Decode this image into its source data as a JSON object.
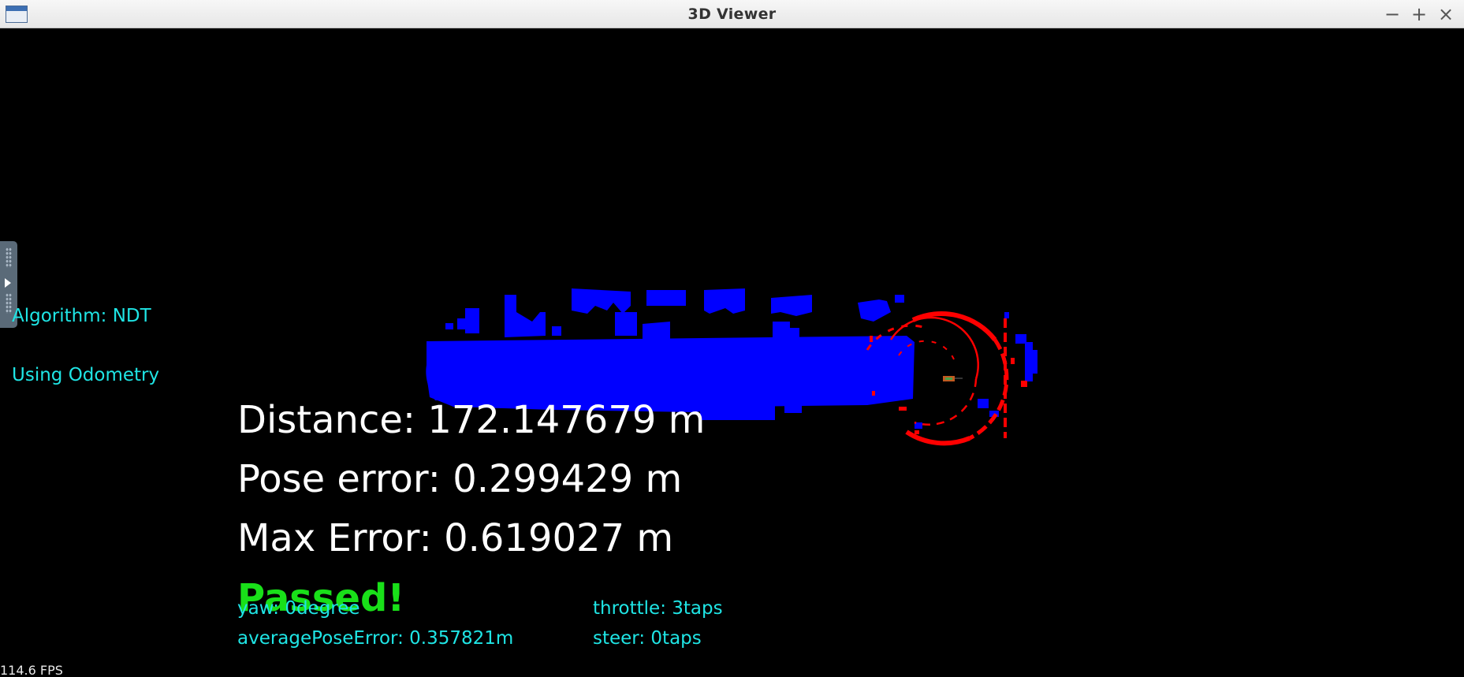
{
  "window": {
    "title": "3D Viewer",
    "app_icon": "window-icon",
    "controls": {
      "minimize": "−",
      "maximize": "+",
      "close": "×"
    }
  },
  "overlay": {
    "algorithm": "Algorithm: NDT",
    "odometry": "Using Odometry",
    "distance": "Distance: 172.147679 m",
    "pose_error": "Pose error: 0.299429 m",
    "max_error": "Max Error: 0.619027 m",
    "status": "Passed!",
    "yaw": "yaw: 0degree",
    "average_pose_error": "averagePoseError: 0.357821m",
    "throttle": "throttle: 3taps",
    "steer": "steer: 0taps",
    "fps": "114.6 FPS"
  },
  "colors": {
    "background": "#000000",
    "map_points": "#0000ff",
    "scan_points": "#ff0000",
    "info_text": "#1fe5e5",
    "metric_text": "#ffffff",
    "status_pass": "#19e019"
  },
  "icons": {
    "side_handle": "panel-expand-icon"
  }
}
